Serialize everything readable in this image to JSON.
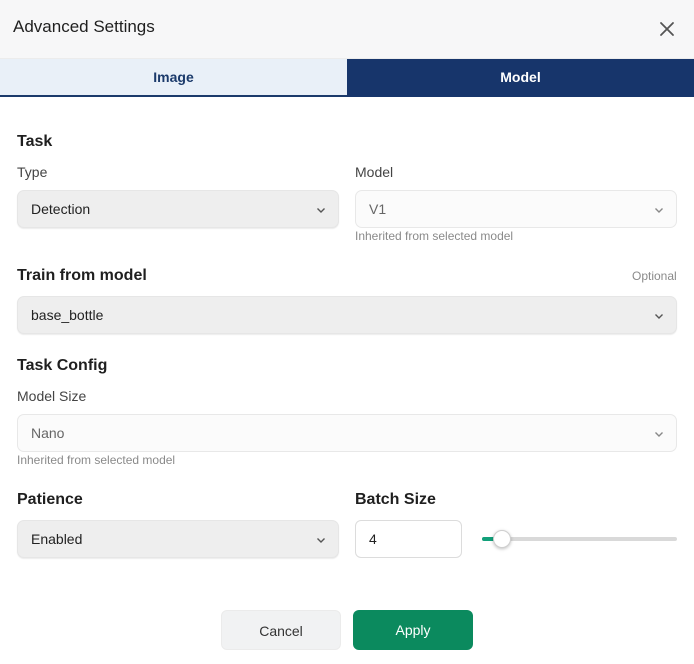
{
  "dialog": {
    "title": "Advanced Settings",
    "close_icon": "close-icon"
  },
  "tabs": [
    {
      "label": "Image",
      "active": false
    },
    {
      "label": "Model",
      "active": true
    }
  ],
  "task": {
    "title": "Task",
    "type": {
      "label": "Type",
      "value": "Detection"
    },
    "model": {
      "label": "Model",
      "value": "V1",
      "hint": "Inherited from selected model",
      "disabled": true
    }
  },
  "train_from_model": {
    "title": "Train from model",
    "optional_label": "Optional",
    "value": "base_bottle"
  },
  "task_config": {
    "title": "Task Config",
    "model_size": {
      "label": "Model Size",
      "value": "Nano",
      "hint": "Inherited from selected model",
      "disabled": true
    }
  },
  "patience": {
    "title": "Patience",
    "value": "Enabled"
  },
  "batch_size": {
    "title": "Batch Size",
    "value": "4",
    "slider_fraction": 0.1
  },
  "footer": {
    "cancel_label": "Cancel",
    "apply_label": "Apply"
  },
  "colors": {
    "primary_navy": "#17356b",
    "apply_green": "#0b8a5e",
    "slider_green": "#12a07a"
  }
}
